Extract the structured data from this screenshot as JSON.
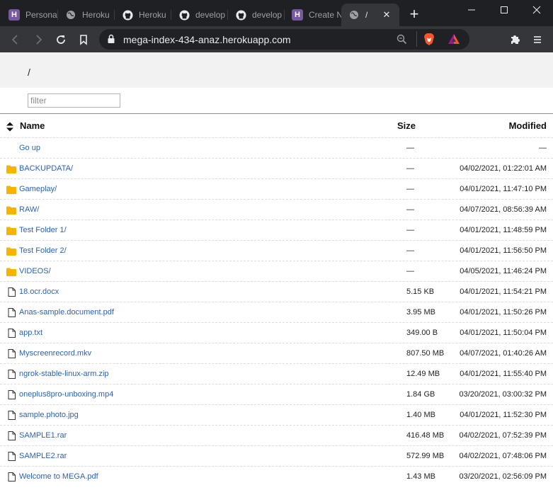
{
  "browser": {
    "tabs": [
      {
        "label": "Personal",
        "icon": "heroku-icon"
      },
      {
        "label": "Heroku",
        "icon": "globe-icon"
      },
      {
        "label": "Heroku",
        "icon": "github-icon"
      },
      {
        "label": "develop",
        "icon": "github-icon"
      },
      {
        "label": "develop",
        "icon": "github-icon"
      },
      {
        "label": "Create N",
        "icon": "heroku-icon"
      },
      {
        "label": "/",
        "icon": "globe-icon",
        "active": true
      }
    ],
    "tab_close": "✕",
    "new_tab": "+",
    "url": "mega-index-434-anaz.herokuapp.com"
  },
  "page": {
    "path": "/",
    "filter_placeholder": "filter",
    "columns": {
      "name": "Name",
      "size": "Size",
      "modified": "Modified"
    },
    "rows": [
      {
        "type": "up",
        "name": "Go up",
        "size": "—",
        "modified": "—"
      },
      {
        "type": "folder",
        "name": "BACKUPDATA/",
        "size": "—",
        "modified": "04/02/2021, 01:22:01 AM"
      },
      {
        "type": "folder",
        "name": "Gameplay/",
        "size": "—",
        "modified": "04/01/2021, 11:47:10 PM"
      },
      {
        "type": "folder",
        "name": "RAW/",
        "size": "—",
        "modified": "04/07/2021, 08:56:39 AM"
      },
      {
        "type": "folder",
        "name": "Test Folder 1/",
        "size": "—",
        "modified": "04/01/2021, 11:48:59 PM"
      },
      {
        "type": "folder",
        "name": "Test Folder 2/",
        "size": "—",
        "modified": "04/01/2021, 11:56:50 PM"
      },
      {
        "type": "folder",
        "name": "VIDEOS/",
        "size": "—",
        "modified": "04/05/2021, 11:46:24 PM"
      },
      {
        "type": "file",
        "name": "18.ocr.docx",
        "size": "5.15 KB",
        "modified": "04/01/2021, 11:54:21 PM"
      },
      {
        "type": "file",
        "name": "Anas-sample.document.pdf",
        "size": "3.95 MB",
        "modified": "04/01/2021, 11:50:26 PM"
      },
      {
        "type": "file",
        "name": "app.txt",
        "size": "349.00 B",
        "modified": "04/01/2021, 11:50:04 PM"
      },
      {
        "type": "file",
        "name": "Myscreenrecord.mkv",
        "size": "807.50 MB",
        "modified": "04/07/2021, 01:40:26 AM"
      },
      {
        "type": "file",
        "name": "ngrok-stable-linux-arm.zip",
        "size": "12.49 MB",
        "modified": "04/01/2021, 11:55:40 PM"
      },
      {
        "type": "file",
        "name": "oneplus8pro-unboxing.mp4",
        "size": "1.84 GB",
        "modified": "03/20/2021, 03:00:32 PM"
      },
      {
        "type": "file",
        "name": "sample.photo.jpg",
        "size": "1.40 MB",
        "modified": "04/01/2021, 11:52:30 PM"
      },
      {
        "type": "file",
        "name": "SAMPLE1.rar",
        "size": "416.48 MB",
        "modified": "04/02/2021, 07:52:39 PM"
      },
      {
        "type": "file",
        "name": "SAMPLE2.rar",
        "size": "572.99 MB",
        "modified": "04/02/2021, 07:48:06 PM"
      },
      {
        "type": "file",
        "name": "Welcome to MEGA.pdf",
        "size": "1.43 MB",
        "modified": "03/20/2021, 02:56:09 PM"
      }
    ]
  },
  "colors": {
    "tabstrip_bg": "#1f2023",
    "toolbar_bg": "#35363a",
    "link": "#2c63b4",
    "folder": "#f5b400",
    "heroku": "#79589f",
    "brave": "#fb542b"
  }
}
